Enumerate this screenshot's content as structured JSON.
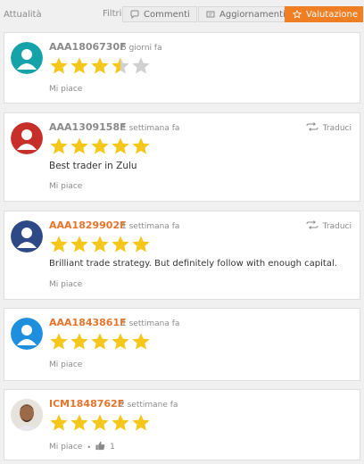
{
  "header": {
    "title": "Attualità",
    "filters_label": "Filtri",
    "tabs": [
      {
        "label": "Commenti",
        "icon": "comment-icon",
        "active": false
      },
      {
        "label": "Aggiornamenti",
        "icon": "update-icon",
        "active": false
      },
      {
        "label": "Valutazione",
        "icon": "star-outline-icon",
        "active": true
      }
    ]
  },
  "colors": {
    "accent": "#f07e22",
    "star": "#f5c71a",
    "star_empty": "#d0d0d0",
    "username_orange": "#e8732a",
    "username_gray": "#8a8a8a"
  },
  "reviews": [
    {
      "user": "AAA1806730F",
      "time": "5 giorni fa",
      "rating": 3.5,
      "comment": "",
      "like": "Mi piace",
      "like_count": "",
      "translate": "",
      "flag": "germany",
      "avatar": "default-avatar-teal"
    },
    {
      "user": "AAA1309158F",
      "time": "1 settimana fa",
      "rating": 5,
      "comment": "Best trader in Zulu",
      "like": "Mi piace",
      "like_count": "",
      "translate": "Traduci",
      "flag": "australia",
      "avatar": "default-avatar-red"
    },
    {
      "user": "AAA1829902F",
      "time": "1 settimana fa",
      "rating": 5,
      "comment": "Brilliant trade strategy. But definitely follow with enough capital.",
      "like": "Mi piace",
      "like_count": "",
      "translate": "Traduci",
      "flag": "uk",
      "avatar": "default-avatar-navy"
    },
    {
      "user": "AAA1843861F",
      "time": "1 settimana fa",
      "rating": 5,
      "comment": "",
      "like": "Mi piace",
      "like_count": "",
      "translate": "",
      "flag": "germany",
      "avatar": "default-avatar-blue"
    },
    {
      "user": "ICM1848762F",
      "time": "2 settimane fa",
      "rating": 5,
      "comment": "",
      "like": "Mi piace",
      "like_count": "1",
      "translate": "",
      "flag": "australia",
      "avatar": "photo-avatar"
    }
  ]
}
